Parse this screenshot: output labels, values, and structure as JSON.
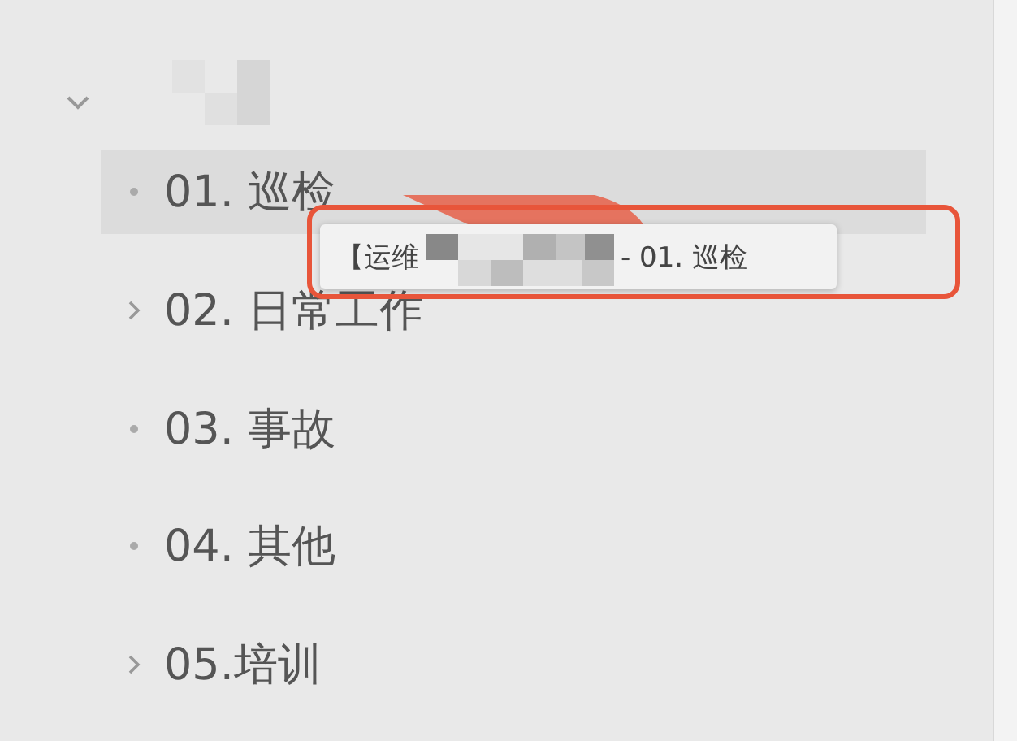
{
  "tree": {
    "expanded": true,
    "children": [
      {
        "label": "01. 巡检",
        "kind": "leaf",
        "selected": true
      },
      {
        "label": "02. 日常工作",
        "kind": "folder",
        "selected": false
      },
      {
        "label": "03. 事故",
        "kind": "leaf",
        "selected": false
      },
      {
        "label": "04. 其他",
        "kind": "leaf",
        "selected": false
      },
      {
        "label": "05.培训",
        "kind": "folder",
        "selected": false
      }
    ]
  },
  "tooltip": {
    "prefix": "【运维",
    "suffix": "- 01. 巡检"
  }
}
